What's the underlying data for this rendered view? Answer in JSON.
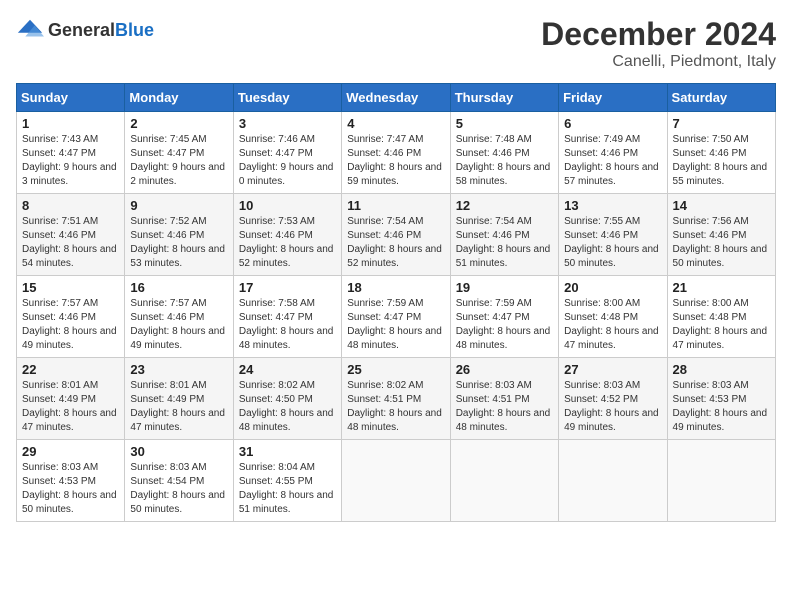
{
  "header": {
    "logo_general": "General",
    "logo_blue": "Blue",
    "month_title": "December 2024",
    "location": "Canelli, Piedmont, Italy"
  },
  "days_of_week": [
    "Sunday",
    "Monday",
    "Tuesday",
    "Wednesday",
    "Thursday",
    "Friday",
    "Saturday"
  ],
  "weeks": [
    [
      {
        "day": "1",
        "sunrise": "7:43 AM",
        "sunset": "4:47 PM",
        "daylight": "9 hours and 3 minutes."
      },
      {
        "day": "2",
        "sunrise": "7:45 AM",
        "sunset": "4:47 PM",
        "daylight": "9 hours and 2 minutes."
      },
      {
        "day": "3",
        "sunrise": "7:46 AM",
        "sunset": "4:47 PM",
        "daylight": "9 hours and 0 minutes."
      },
      {
        "day": "4",
        "sunrise": "7:47 AM",
        "sunset": "4:46 PM",
        "daylight": "8 hours and 59 minutes."
      },
      {
        "day": "5",
        "sunrise": "7:48 AM",
        "sunset": "4:46 PM",
        "daylight": "8 hours and 58 minutes."
      },
      {
        "day": "6",
        "sunrise": "7:49 AM",
        "sunset": "4:46 PM",
        "daylight": "8 hours and 57 minutes."
      },
      {
        "day": "7",
        "sunrise": "7:50 AM",
        "sunset": "4:46 PM",
        "daylight": "8 hours and 55 minutes."
      }
    ],
    [
      {
        "day": "8",
        "sunrise": "7:51 AM",
        "sunset": "4:46 PM",
        "daylight": "8 hours and 54 minutes."
      },
      {
        "day": "9",
        "sunrise": "7:52 AM",
        "sunset": "4:46 PM",
        "daylight": "8 hours and 53 minutes."
      },
      {
        "day": "10",
        "sunrise": "7:53 AM",
        "sunset": "4:46 PM",
        "daylight": "8 hours and 52 minutes."
      },
      {
        "day": "11",
        "sunrise": "7:54 AM",
        "sunset": "4:46 PM",
        "daylight": "8 hours and 52 minutes."
      },
      {
        "day": "12",
        "sunrise": "7:54 AM",
        "sunset": "4:46 PM",
        "daylight": "8 hours and 51 minutes."
      },
      {
        "day": "13",
        "sunrise": "7:55 AM",
        "sunset": "4:46 PM",
        "daylight": "8 hours and 50 minutes."
      },
      {
        "day": "14",
        "sunrise": "7:56 AM",
        "sunset": "4:46 PM",
        "daylight": "8 hours and 50 minutes."
      }
    ],
    [
      {
        "day": "15",
        "sunrise": "7:57 AM",
        "sunset": "4:46 PM",
        "daylight": "8 hours and 49 minutes."
      },
      {
        "day": "16",
        "sunrise": "7:57 AM",
        "sunset": "4:46 PM",
        "daylight": "8 hours and 49 minutes."
      },
      {
        "day": "17",
        "sunrise": "7:58 AM",
        "sunset": "4:47 PM",
        "daylight": "8 hours and 48 minutes."
      },
      {
        "day": "18",
        "sunrise": "7:59 AM",
        "sunset": "4:47 PM",
        "daylight": "8 hours and 48 minutes."
      },
      {
        "day": "19",
        "sunrise": "7:59 AM",
        "sunset": "4:47 PM",
        "daylight": "8 hours and 48 minutes."
      },
      {
        "day": "20",
        "sunrise": "8:00 AM",
        "sunset": "4:48 PM",
        "daylight": "8 hours and 47 minutes."
      },
      {
        "day": "21",
        "sunrise": "8:00 AM",
        "sunset": "4:48 PM",
        "daylight": "8 hours and 47 minutes."
      }
    ],
    [
      {
        "day": "22",
        "sunrise": "8:01 AM",
        "sunset": "4:49 PM",
        "daylight": "8 hours and 47 minutes."
      },
      {
        "day": "23",
        "sunrise": "8:01 AM",
        "sunset": "4:49 PM",
        "daylight": "8 hours and 47 minutes."
      },
      {
        "day": "24",
        "sunrise": "8:02 AM",
        "sunset": "4:50 PM",
        "daylight": "8 hours and 48 minutes."
      },
      {
        "day": "25",
        "sunrise": "8:02 AM",
        "sunset": "4:51 PM",
        "daylight": "8 hours and 48 minutes."
      },
      {
        "day": "26",
        "sunrise": "8:03 AM",
        "sunset": "4:51 PM",
        "daylight": "8 hours and 48 minutes."
      },
      {
        "day": "27",
        "sunrise": "8:03 AM",
        "sunset": "4:52 PM",
        "daylight": "8 hours and 49 minutes."
      },
      {
        "day": "28",
        "sunrise": "8:03 AM",
        "sunset": "4:53 PM",
        "daylight": "8 hours and 49 minutes."
      }
    ],
    [
      {
        "day": "29",
        "sunrise": "8:03 AM",
        "sunset": "4:53 PM",
        "daylight": "8 hours and 50 minutes."
      },
      {
        "day": "30",
        "sunrise": "8:03 AM",
        "sunset": "4:54 PM",
        "daylight": "8 hours and 50 minutes."
      },
      {
        "day": "31",
        "sunrise": "8:04 AM",
        "sunset": "4:55 PM",
        "daylight": "8 hours and 51 minutes."
      },
      null,
      null,
      null,
      null
    ]
  ]
}
